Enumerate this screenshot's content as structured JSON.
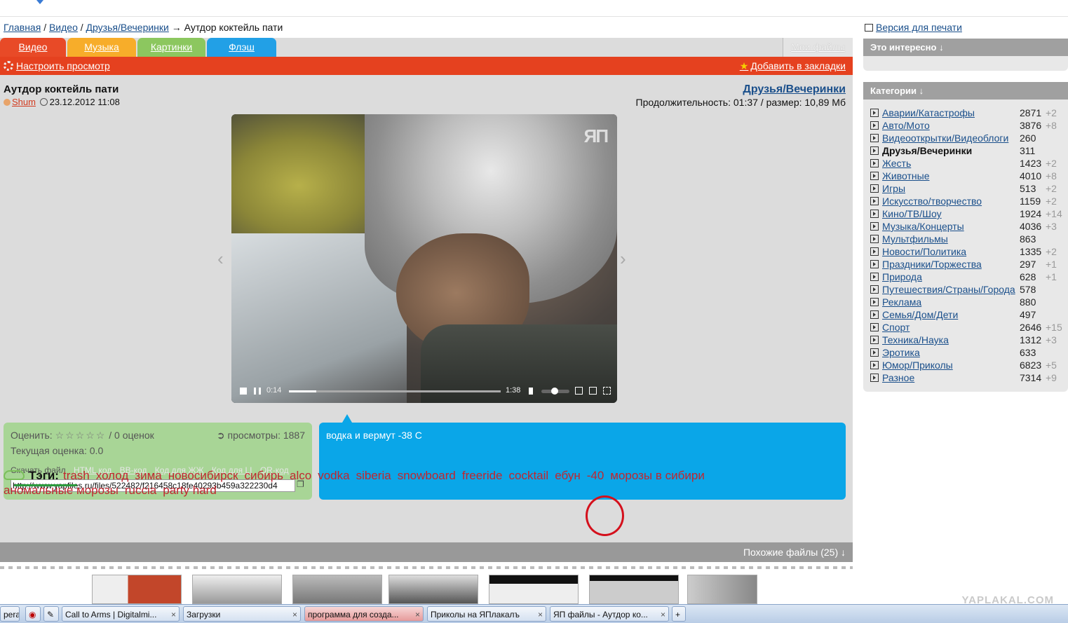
{
  "breadcrumb": {
    "home": "Главная",
    "video": "Видео",
    "category": "Друзья/Вечеринки",
    "arrow": "→",
    "current": "Аутдор коктейль пати",
    "slash": "/"
  },
  "tabs": {
    "video": "Видео",
    "music": "Музыка",
    "pictures": "Картинки",
    "flash": "Флэш",
    "my_files": "Мои файлы"
  },
  "toolbar": {
    "configure": "Настроить просмотр",
    "bookmark": "Добавить в закладки"
  },
  "file": {
    "title": "Аутдор коктейль пати",
    "author": "Shum",
    "date": "23.12.2012 11:08",
    "category": "Друзья/Вечеринки",
    "duration_text": "Продолжительность: 01:37 / размер: 10,89 Мб"
  },
  "player": {
    "logo": "ЯП",
    "time_current": "0:14",
    "time_total": "1:38",
    "progress": 0.13
  },
  "rating": {
    "rate_label": "Оценить:",
    "stars": "☆☆☆☆☆",
    "votes": "/ 0 оценок",
    "views": "просмотры: 1887",
    "current": "Текущая оценка: 0.0",
    "download": "Скачать файл",
    "codes": [
      "HTML код",
      "BB-код",
      "Код для ЖЖ",
      "Код для LI",
      "QR-код"
    ],
    "url": "http://www.yapfiles.ru/files/522482/f216458c18fe40293b459a322230d4"
  },
  "description": "водка и вермут -38 С",
  "tags": {
    "label": "Тэги:",
    "items": [
      "trash",
      "холод",
      "зима",
      "новосибирск",
      "сибирь",
      "alco",
      "vodka",
      "siberia",
      "snowboard",
      "freeride",
      "cocktail",
      "ебун",
      "-40",
      "морозы в сибири",
      "аномальные морозы",
      "ruccia",
      "party hard"
    ]
  },
  "similar": "Похожие файлы (25) ↓",
  "sidebar": {
    "print": "Версия для печати",
    "interesting": "Это интересно ↓",
    "categories_header": "Категории ↓",
    "categories": [
      {
        "name": "Аварии/Катастрофы",
        "count": "2871",
        "inc": "+2"
      },
      {
        "name": "Авто/Мото",
        "count": "3876",
        "inc": "+8"
      },
      {
        "name": "Видеооткрытки/Видеоблоги",
        "count": "260",
        "inc": ""
      },
      {
        "name": "Друзья/Вечеринки",
        "count": "311",
        "inc": ""
      },
      {
        "name": "Жесть",
        "count": "1423",
        "inc": "+2"
      },
      {
        "name": "Животные",
        "count": "4010",
        "inc": "+8"
      },
      {
        "name": "Игры",
        "count": "513",
        "inc": "+2"
      },
      {
        "name": "Искусство/творчество",
        "count": "1159",
        "inc": "+2"
      },
      {
        "name": "Кино/ТВ/Шоу",
        "count": "1924",
        "inc": "+14"
      },
      {
        "name": "Музыка/Концерты",
        "count": "4036",
        "inc": "+3"
      },
      {
        "name": "Мультфильмы",
        "count": "863",
        "inc": ""
      },
      {
        "name": "Новости/Политика",
        "count": "1335",
        "inc": "+2"
      },
      {
        "name": "Праздники/Торжества",
        "count": "297",
        "inc": "+1"
      },
      {
        "name": "Природа",
        "count": "628",
        "inc": "+1"
      },
      {
        "name": "Путешествия/Страны/Города",
        "count": "578",
        "inc": ""
      },
      {
        "name": "Реклама",
        "count": "880",
        "inc": ""
      },
      {
        "name": "Семья/Дом/Дети",
        "count": "497",
        "inc": ""
      },
      {
        "name": "Спорт",
        "count": "2646",
        "inc": "+15"
      },
      {
        "name": "Техника/Наука",
        "count": "1312",
        "inc": "+3"
      },
      {
        "name": "Эротика",
        "count": "633",
        "inc": ""
      },
      {
        "name": "Юмор/Приколы",
        "count": "6823",
        "inc": "+5"
      },
      {
        "name": "Разное",
        "count": "7314",
        "inc": "+9"
      }
    ]
  },
  "taskbar": {
    "items": [
      {
        "label": "pera"
      },
      {
        "label": "Call to Arms | Digitalmi..."
      },
      {
        "label": "Загрузки"
      },
      {
        "label": "программа для созда..."
      },
      {
        "label": "Приколы на ЯПлакалъ"
      },
      {
        "label": "ЯП файлы - Аутдор ко..."
      }
    ]
  },
  "watermark": "YAPLAKAL.COM"
}
